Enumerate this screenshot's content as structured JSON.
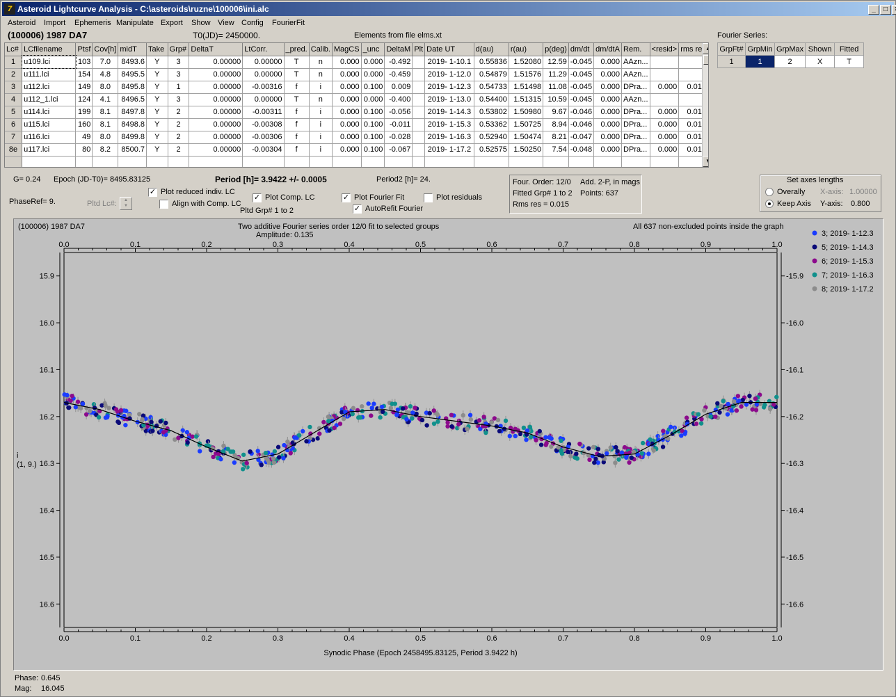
{
  "window": {
    "title": "Asteroid Lightcurve Analysis - C:\\asteroids\\ruzne\\100006\\ini.alc"
  },
  "menu": [
    "Asteroid",
    "Import",
    "Ephemeris",
    "Manipulate",
    "Export",
    "Show",
    "View",
    "Config",
    "FourierFit"
  ],
  "header": {
    "object": "(100006) 1987 DA7",
    "t0": "T0(JD)= 2450000.",
    "elements": "Elements from file elms.xt",
    "fourier_label": "Fourier Series:"
  },
  "lc_table": {
    "columns": [
      "Lc#",
      "LCfilename",
      "Ptsf",
      "Cov[h]",
      "midT",
      "Take",
      "Grp#",
      "DeltaT",
      "LtCorr.",
      "_pred.",
      "Calib.",
      "MagCS",
      "_unc",
      "DeltaM",
      "Plt",
      "Date UT",
      "d(au)",
      "r(au)",
      "p(deg)",
      "dm/dt",
      "dm/dtA",
      "Rem.",
      "<resid>",
      "rms res"
    ],
    "rows": [
      [
        "1",
        "u109.lci",
        "103",
        "7.0",
        "8493.6",
        "Y",
        "3",
        "0.00000",
        "0.00000",
        "T",
        "n",
        "0.000",
        "0.000",
        "-0.492",
        "",
        "2019- 1-10.1",
        "0.55836",
        "1.52080",
        "12.59",
        "-0.045",
        "0.000",
        "AAzn...",
        "",
        ""
      ],
      [
        "2",
        "u111.lci",
        "154",
        "4.8",
        "8495.5",
        "Y",
        "3",
        "0.00000",
        "0.00000",
        "T",
        "n",
        "0.000",
        "0.000",
        "-0.459",
        "",
        "2019- 1-12.0",
        "0.54879",
        "1.51576",
        "11.29",
        "-0.045",
        "0.000",
        "AAzn...",
        "",
        ""
      ],
      [
        "3",
        "u112.lci",
        "149",
        "8.0",
        "8495.8",
        "Y",
        "1",
        "0.00000",
        "-0.00316",
        "f",
        "i",
        "0.000",
        "0.100",
        "0.009",
        "",
        "2019- 1-12.3",
        "0.54733",
        "1.51498",
        "11.08",
        "-0.045",
        "0.000",
        "DPra...",
        "0.000",
        "0.014"
      ],
      [
        "4",
        "u112_1.lci",
        "124",
        "4.1",
        "8496.5",
        "Y",
        "3",
        "0.00000",
        "0.00000",
        "T",
        "n",
        "0.000",
        "0.000",
        "-0.400",
        "",
        "2019- 1-13.0",
        "0.54400",
        "1.51315",
        "10.59",
        "-0.045",
        "0.000",
        "AAzn...",
        "",
        ""
      ],
      [
        "5",
        "u114.lci",
        "199",
        "8.1",
        "8497.8",
        "Y",
        "2",
        "0.00000",
        "-0.00311",
        "f",
        "i",
        "0.000",
        "0.100",
        "-0.056",
        "",
        "2019- 1-14.3",
        "0.53802",
        "1.50980",
        "9.67",
        "-0.046",
        "0.000",
        "DPra...",
        "0.000",
        "0.013"
      ],
      [
        "6",
        "u115.lci",
        "160",
        "8.1",
        "8498.8",
        "Y",
        "2",
        "0.00000",
        "-0.00308",
        "f",
        "i",
        "0.000",
        "0.100",
        "-0.011",
        "",
        "2019- 1-15.3",
        "0.53362",
        "1.50725",
        "8.94",
        "-0.046",
        "0.000",
        "DPra...",
        "0.000",
        "0.018"
      ],
      [
        "7",
        "u116.lci",
        "49",
        "8.0",
        "8499.8",
        "Y",
        "2",
        "0.00000",
        "-0.00306",
        "f",
        "i",
        "0.000",
        "0.100",
        "-0.028",
        "",
        "2019- 1-16.3",
        "0.52940",
        "1.50474",
        "8.21",
        "-0.047",
        "0.000",
        "DPra...",
        "0.000",
        "0.013"
      ],
      [
        "8e",
        "u117.lci",
        "80",
        "8.2",
        "8500.7",
        "Y",
        "2",
        "0.00000",
        "-0.00304",
        "f",
        "i",
        "0.000",
        "0.100",
        "-0.067",
        "",
        "2019- 1-17.2",
        "0.52575",
        "1.50250",
        "7.54",
        "-0.048",
        "0.000",
        "DPra...",
        "0.000",
        "0.013"
      ]
    ]
  },
  "fourier_table": {
    "columns": [
      "GrpFt#",
      "GrpMin",
      "GrpMax",
      "Shown",
      "Fitted"
    ],
    "row": [
      "1",
      "1",
      "2",
      "X",
      "T"
    ]
  },
  "controls": {
    "g_value": "G= 0.24",
    "epoch": "Epoch (JD-T0)= 8495.83125",
    "period": "Period [h]= 3.9422 +/- 0.0005",
    "period2": "Period2 [h]= 24.",
    "phaseref": "PhaseRef= 9.",
    "pltd_lc": "Pltd Lc#:",
    "plot_reduced": "Plot reduced indiv. LC",
    "align_comp": "Align with Comp. LC",
    "plot_comp": "Plot Comp. LC",
    "pltd_grp": "Pltd Grp#  1   to   2",
    "plot_fourier": "Plot Fourier Fit",
    "autorefit": "AutoRefit Fourier",
    "plot_residuals": "Plot residuals",
    "checked": {
      "plot_reduced": true,
      "align_comp": false,
      "plot_comp": true,
      "plot_fourier": true,
      "autorefit": true,
      "plot_residuals": false
    }
  },
  "info": {
    "order": "Four. Order: 12/0",
    "add": "Add. 2-P, in mags",
    "fitted": "Fitted Grp# 1 to 2",
    "points": "Points: 637",
    "rms": "Rms res     = 0.015"
  },
  "axes_box": {
    "title": "Set axes lengths",
    "overally": "Overally",
    "keep": "Keep Axis",
    "xaxis_label": "X-axis:",
    "xaxis_val": "1.00000",
    "yaxis_label": "Y-axis:",
    "yaxis_val": "0.800",
    "selected": "keep"
  },
  "plot": {
    "title_left": "(100006) 1987 DA7",
    "title_center": "Two additive Fourier series order 12/0 fit to selected groups",
    "amplitude": "Amplitude: 0.135",
    "title_right": "All 637 non-excluded points inside the graph",
    "ylabel": "i",
    "ylabel2": "(1, 9.)"
  },
  "chart_data": {
    "type": "scatter",
    "xlabel": "Synodic Phase (Epoch 2458495.83125, Period 3.9422 h)",
    "ylabel": "i",
    "xlim": [
      0,
      1
    ],
    "ylim": [
      16.65,
      15.85
    ],
    "x_ticks": [
      "0.0",
      "0.1",
      "0.2",
      "0.3",
      "0.4",
      "0.5",
      "0.6",
      "0.7",
      "0.8",
      "0.9",
      "1.0"
    ],
    "y_ticks": [
      "15.9",
      "16.0",
      "16.1",
      "16.2",
      "16.3",
      "16.4",
      "16.5",
      "16.6"
    ],
    "legend_position": "right",
    "series": [
      {
        "name": "3; 2019- 1-12.3",
        "color": "#1a3cff"
      },
      {
        "name": "5; 2019- 1-14.3",
        "color": "#0a0a78"
      },
      {
        "name": "6; 2019- 1-15.3",
        "color": "#8c0a8c"
      },
      {
        "name": "7; 2019- 1-16.3",
        "color": "#10908c"
      },
      {
        "name": "8; 2019- 1-17.2",
        "color": "#8c8c8c"
      }
    ],
    "fit_curve": {
      "x": [
        0.0,
        0.05,
        0.1,
        0.15,
        0.2,
        0.25,
        0.3,
        0.35,
        0.4,
        0.45,
        0.5,
        0.55,
        0.6,
        0.65,
        0.7,
        0.75,
        0.8,
        0.85,
        0.9,
        0.95,
        1.0
      ],
      "y": [
        16.17,
        16.185,
        16.21,
        16.23,
        16.265,
        16.295,
        16.28,
        16.235,
        16.19,
        16.185,
        16.2,
        16.21,
        16.22,
        16.235,
        16.265,
        16.285,
        16.28,
        16.24,
        16.195,
        16.17,
        16.17
      ]
    }
  },
  "status": {
    "phase_label": "Phase:",
    "phase_val": "0.645",
    "mag_label": "Mag:",
    "mag_val": "16.045"
  }
}
